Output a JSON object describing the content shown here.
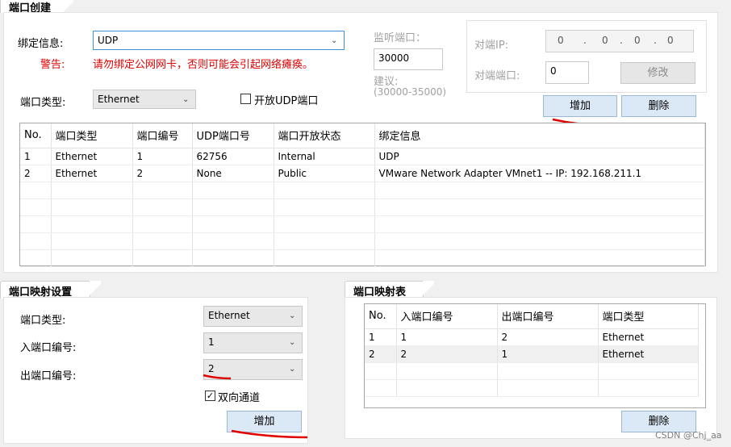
{
  "port_create": {
    "tab_title": "端口创建",
    "bind_info_label": "绑定信息:",
    "bind_info_value": "UDP",
    "warning_label": "警告:",
    "warning_text": "请勿绑定公网网卡，否则可能会引起网络瘫痪。",
    "port_type_label": "端口类型:",
    "port_type_value": "Ethernet",
    "open_udp_label": "开放UDP端口",
    "listen_port_label": "监听端口：",
    "listen_port_value": "30000",
    "suggest_label": "建议:",
    "suggest_range": "(30000-35000)",
    "peer_ip_label": "对端IP:",
    "peer_ip_value": [
      " 0",
      "0",
      "0",
      "0"
    ],
    "peer_port_label": "对端端口:",
    "peer_port_value": "0",
    "modify_button": "修改",
    "add_button": "增加",
    "delete_button": "删除",
    "table": {
      "columns": [
        "No.",
        "端口类型",
        "端口编号",
        "UDP端口号",
        "端口开放状态",
        "绑定信息"
      ],
      "rows": [
        [
          "1",
          "Ethernet",
          "1",
          "62756",
          "Internal",
          "UDP"
        ],
        [
          "2",
          "Ethernet",
          "2",
          "None",
          "Public",
          "VMware Network Adapter VMnet1 -- IP: 192.168.211.1"
        ]
      ]
    }
  },
  "port_mapping_settings": {
    "tab_title": "端口映射设置",
    "port_type_label": "端口类型:",
    "port_type_value": "Ethernet",
    "in_port_label": "入端口编号:",
    "in_port_value": "1",
    "out_port_label": "出端口编号:",
    "out_port_value": "2",
    "bidirectional_label": "双向通道",
    "add_button": "增加"
  },
  "port_mapping_table": {
    "tab_title": "端口映射表",
    "columns": [
      "No.",
      "入端口编号",
      "出端口编号",
      "端口类型"
    ],
    "rows": [
      [
        "1",
        "1",
        "2",
        "Ethernet"
      ],
      [
        "2",
        "2",
        "1",
        "Ethernet"
      ]
    ],
    "delete_button": "删除"
  },
  "watermark": "CSDN @Chj_aa",
  "colors": {
    "annotation_red": "#e00000",
    "warning_red": "#e00000"
  }
}
